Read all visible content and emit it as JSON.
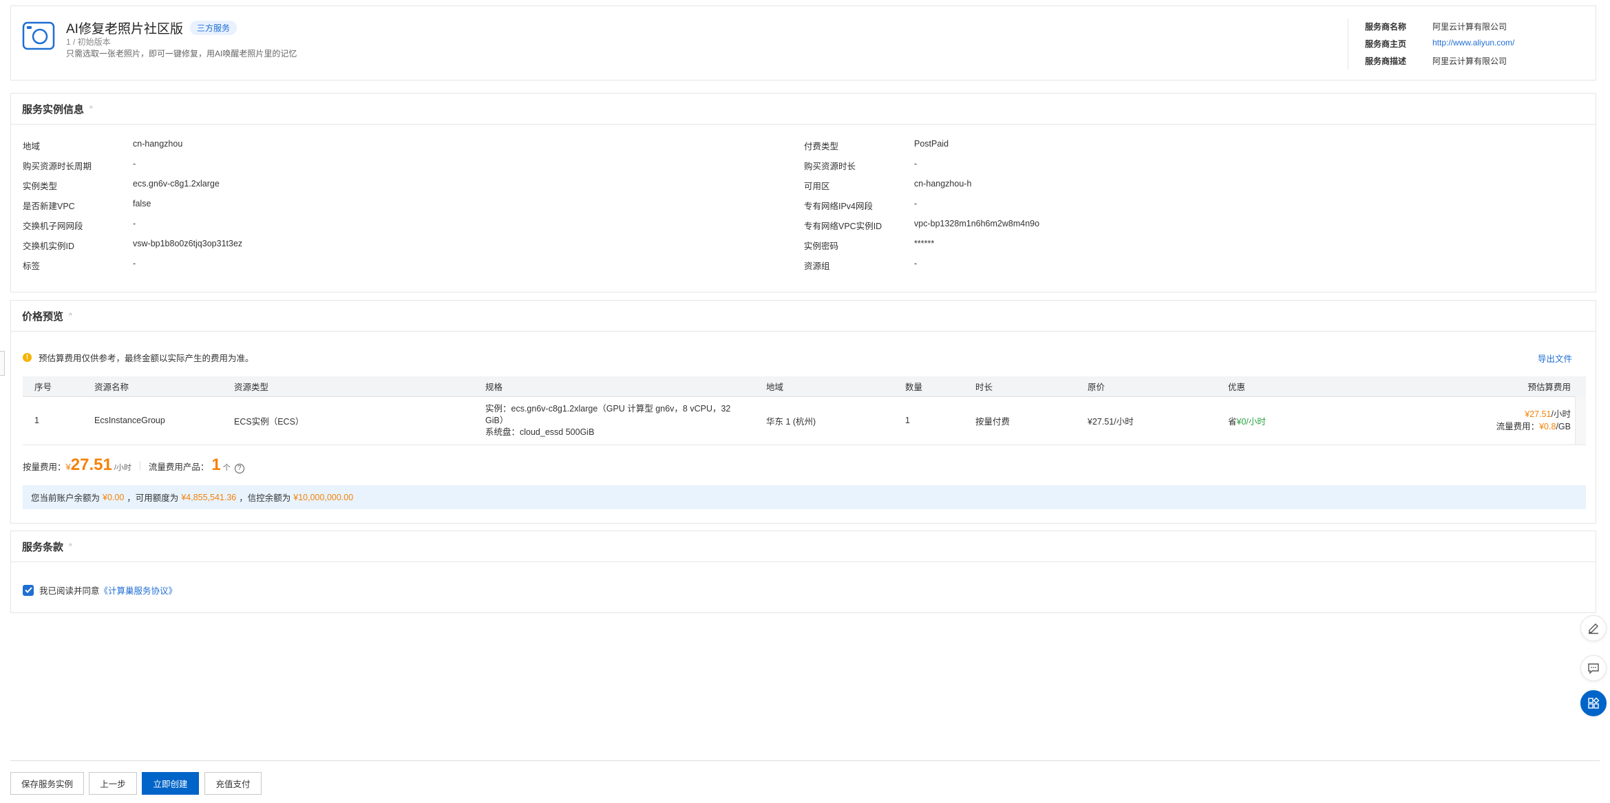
{
  "header": {
    "title": "AI修复老照片社区版",
    "badge": "三方服务",
    "version": "1 / 初始版本",
    "description": "只需选取一张老照片，即可一键修复，用AI唤醒老照片里的记忆",
    "provider": [
      {
        "label": "服务商名称",
        "value": "阿里云计算有限公司",
        "link": false
      },
      {
        "label": "服务商主页",
        "value": "http://www.aliyun.com/",
        "link": true
      },
      {
        "label": "服务商描述",
        "value": "阿里云计算有限公司",
        "link": false
      }
    ]
  },
  "instance": {
    "title": "服务实例信息",
    "left": [
      {
        "label": "地域",
        "value": "cn-hangzhou"
      },
      {
        "label": "购买资源时长周期",
        "value": "-"
      },
      {
        "label": "实例类型",
        "value": "ecs.gn6v-c8g1.2xlarge"
      },
      {
        "label": "是否新建VPC",
        "value": "false"
      },
      {
        "label": "交换机子网网段",
        "value": "-"
      },
      {
        "label": "交换机实例ID",
        "value": "vsw-bp1b8o0z6tjq3op31t3ez"
      },
      {
        "label": "标签",
        "value": "-"
      }
    ],
    "right": [
      {
        "label": "付费类型",
        "value": "PostPaid"
      },
      {
        "label": "购买资源时长",
        "value": "-"
      },
      {
        "label": "可用区",
        "value": "cn-hangzhou-h"
      },
      {
        "label": "专有网络IPv4网段",
        "value": "-"
      },
      {
        "label": "专有网络VPC实例ID",
        "value": "vpc-bp1328m1n6h6m2w8m4n9o"
      },
      {
        "label": "实例密码",
        "value": "******"
      },
      {
        "label": "资源组",
        "value": "-"
      }
    ]
  },
  "price": {
    "title": "价格预览",
    "notice": "预估算费用仅供参考，最终金额以实际产生的费用为准。",
    "export_label": "导出文件",
    "columns": [
      "序号",
      "资源名称",
      "资源类型",
      "规格",
      "地域",
      "数量",
      "时长",
      "原价",
      "优惠",
      "预估算费用"
    ],
    "row": {
      "index": "1",
      "name": "EcsInstanceGroup",
      "type": "ECS实例（ECS）",
      "spec_line1": "实例：ecs.gn6v-c8g1.2xlarge（GPU 计算型 gn6v，8 vCPU，32",
      "spec_line2": "GiB）",
      "spec_line3": "系统盘：cloud_essd 500GiB",
      "region": "华东 1 (杭州)",
      "qty": "1",
      "duration": "按量付费",
      "orig_price": "¥27.51/小时",
      "discount_prefix": "省",
      "discount_value": "¥0/小时",
      "est_price": "¥27.51",
      "est_unit": "/小时",
      "traffic_label": "流量费用：",
      "traffic_price": "¥0.8",
      "traffic_unit": "/GB"
    },
    "fee_label": "按量费用：",
    "fee_currency": "¥",
    "fee_amount": "27.51",
    "fee_unit": "/小时",
    "traffic_products_label": "流量费用产品：",
    "traffic_products_count": "1",
    "traffic_products_unit": "个",
    "balance": {
      "part1": "您当前账户余额为",
      "balance": "¥0.00",
      "part2": "，可用额度为",
      "available": "¥4,855,541.36",
      "part3": "，信控余额为",
      "credit": "¥10,000,000.00"
    }
  },
  "terms": {
    "title": "服务条款",
    "agree_text": "我已阅读并同意",
    "agreement_link": "《计算巢服务协议》"
  },
  "footer": {
    "save_label": "保存服务实例",
    "prev_label": "上一步",
    "create_label": "立即创建",
    "recharge_label": "充值支付"
  },
  "colors": {
    "primary": "#0064c8",
    "accent_orange": "#f5820a",
    "discount_green": "#2aa13e",
    "link_blue": "#1f6ed4"
  }
}
